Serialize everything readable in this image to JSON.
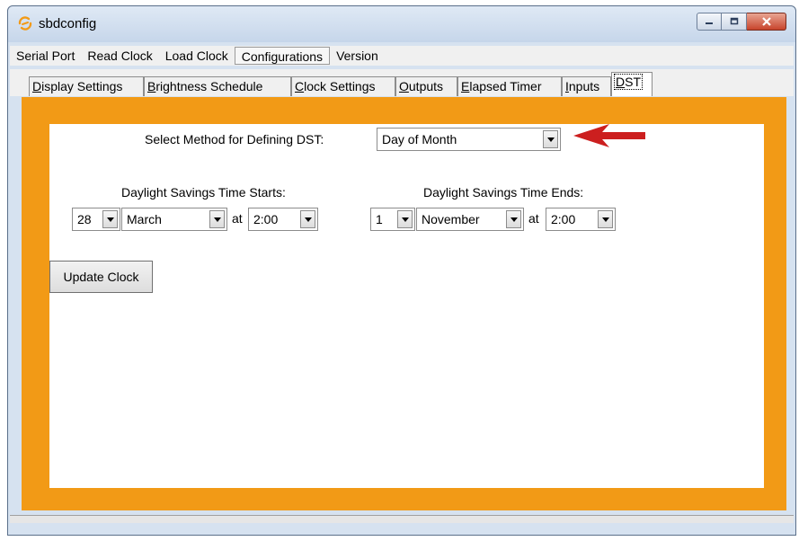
{
  "window": {
    "title": "sbdconfig",
    "icon": "sbd-logo-icon",
    "accent_color": "#f29a16"
  },
  "menubar": {
    "items": [
      {
        "label": "Serial Port"
      },
      {
        "label": "Read Clock"
      },
      {
        "label": "Load Clock"
      },
      {
        "label": "Configurations",
        "active": true
      },
      {
        "label": "Version"
      }
    ]
  },
  "tabs": [
    {
      "first": "D",
      "rest": "isplay Settings"
    },
    {
      "first": "B",
      "rest": "rightness Schedule"
    },
    {
      "first": "C",
      "rest": "lock Settings"
    },
    {
      "first": "O",
      "rest": "utputs"
    },
    {
      "first": "E",
      "rest": "lapsed Timer"
    },
    {
      "first": "I",
      "rest": "nputs"
    },
    {
      "first": "D",
      "rest": "ST",
      "selected": true
    }
  ],
  "dst": {
    "method_label": "Select Method for Defining DST:",
    "method_value": "Day of Month",
    "starts": {
      "label": "Daylight Savings Time Starts:",
      "day": "28",
      "month": "March",
      "at": "at",
      "time": "2:00"
    },
    "ends": {
      "label": "Daylight Savings Time Ends:",
      "day": "1",
      "month": "November",
      "at": "at",
      "time": "2:00"
    },
    "update_button": "Update Clock"
  },
  "annotation_color": "#cc1f1f"
}
